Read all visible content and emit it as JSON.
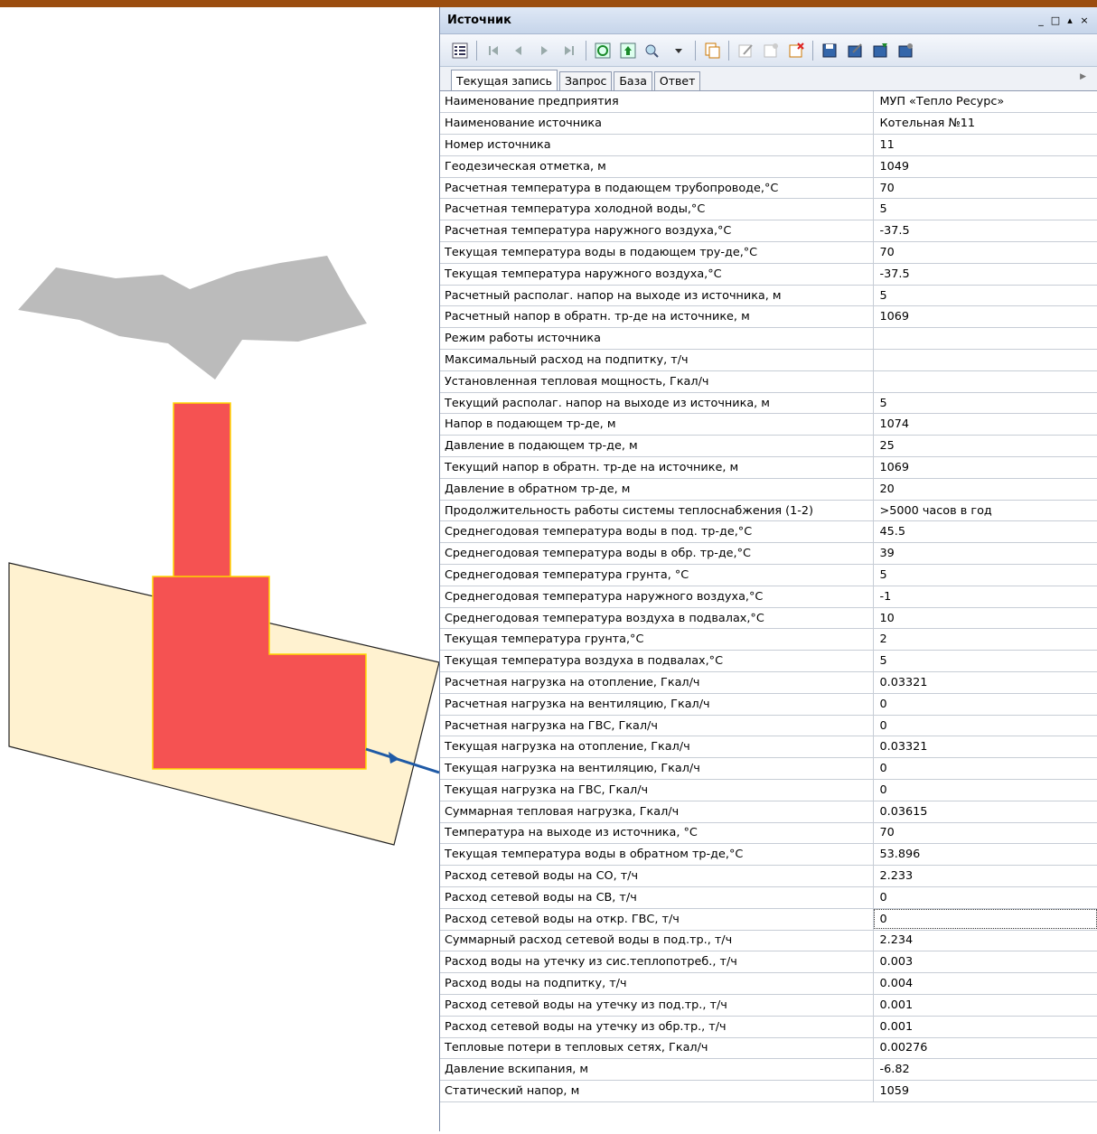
{
  "window": {
    "title": "Источник",
    "controls": [
      "_",
      "□",
      "▴",
      "×"
    ]
  },
  "toolbar": {
    "icons": [
      "grid-menu-icon",
      "first-record-icon",
      "prev-record-icon",
      "next-record-icon",
      "last-record-icon",
      "refresh-icon",
      "update-icon",
      "find-icon",
      "copy-icon",
      "edit-icon",
      "new-record-icon",
      "delete-record-icon",
      "save-icon",
      "export-icon",
      "import-icon",
      "settings-icon"
    ]
  },
  "tabs": [
    "Текущая запись",
    "Запрос",
    "База",
    "Ответ"
  ],
  "rows": [
    {
      "k": "Наименование предприятия",
      "v": "МУП «Тепло Ресурс»"
    },
    {
      "k": "Наименование источника",
      "v": "Котельная №11"
    },
    {
      "k": "Номер источника",
      "v": "11"
    },
    {
      "k": "Геодезическая отметка, м",
      "v": "1049"
    },
    {
      "k": "Расчетная температура в подающем трубопроводе,°С",
      "v": "70"
    },
    {
      "k": "Расчетная температура холодной воды,°С",
      "v": "5"
    },
    {
      "k": "Расчетная температура наружного воздуха,°С",
      "v": "-37.5"
    },
    {
      "k": "Текущая температура воды в подающем тру-де,°С",
      "v": "70"
    },
    {
      "k": "Текущая температура  наружного воздуха,°С",
      "v": "-37.5"
    },
    {
      "k": "Расчетный располаг. напор на выходе из источника, м",
      "v": "5"
    },
    {
      "k": "Расчетный напор в обратн. тр-де на источнике, м",
      "v": "1069"
    },
    {
      "k": "Режим работы источника",
      "v": ""
    },
    {
      "k": "Максимальный расход на подпитку, т/ч",
      "v": ""
    },
    {
      "k": "Установленная тепловая мощность, Гкал/ч",
      "v": ""
    },
    {
      "k": "Текущий располаг. напор на выходе из источника, м",
      "v": "5"
    },
    {
      "k": "Напор в подающем тр-де, м",
      "v": "1074"
    },
    {
      "k": "Давление в подающем тр-де, м",
      "v": "25"
    },
    {
      "k": "Текущий напор в обратн. тр-де на источнике, м",
      "v": "1069"
    },
    {
      "k": "Давление в обратном тр-де, м",
      "v": "20"
    },
    {
      "k": "Продолжительность работы системы теплоснабжения (1-2)",
      "v": ">5000 часов в год"
    },
    {
      "k": "Среднегодовая температура воды в под. тр-де,°С",
      "v": "45.5"
    },
    {
      "k": "Среднегодовая температура воды в обр. тр-де,°С",
      "v": "39"
    },
    {
      "k": "Среднегодовая температура грунта, °С",
      "v": "5"
    },
    {
      "k": "Среднегодовая температура наружного воздуха,°С",
      "v": "-1"
    },
    {
      "k": "Среднегодовая температура воздуха в подвалах,°С",
      "v": "10"
    },
    {
      "k": "Текущая температура грунта,°С",
      "v": "2"
    },
    {
      "k": "Текущая температура воздуха в подвалах,°С",
      "v": "5"
    },
    {
      "k": "Расчетная нагрузка на отопление, Гкал/ч",
      "v": "0.03321"
    },
    {
      "k": "Расчетная нагрузка на вентиляцию, Гкал/ч",
      "v": "0"
    },
    {
      "k": "Расчетная нагрузка на ГВС, Гкал/ч",
      "v": "0"
    },
    {
      "k": "Текущая нагрузка на отопление, Гкал/ч",
      "v": "0.03321"
    },
    {
      "k": "Текущая нагрузка на вентиляцию, Гкал/ч",
      "v": "0"
    },
    {
      "k": "Текущая нагрузка на ГВС, Гкал/ч",
      "v": "0"
    },
    {
      "k": "Суммарная тепловая нагрузка, Гкал/ч",
      "v": "0.03615"
    },
    {
      "k": "Температура на выходе из источника, °С",
      "v": "70"
    },
    {
      "k": "Текущая температура воды в обратном тр-де,°С",
      "v": "53.896"
    },
    {
      "k": "Расход сетевой воды на СО, т/ч",
      "v": "2.233"
    },
    {
      "k": "Расход сетевой воды на СВ, т/ч",
      "v": "0"
    },
    {
      "k": "Расход сетевой воды на откр. ГВС, т/ч",
      "v": "0"
    },
    {
      "k": "Суммарный расход сетевой воды в под.тр., т/ч",
      "v": "2.234"
    },
    {
      "k": "Расход воды на утечку из сис.теплопотреб., т/ч",
      "v": "0.003"
    },
    {
      "k": "Расход воды на подпитку, т/ч",
      "v": "0.004"
    },
    {
      "k": "Расход сетевой воды на утечку из под.тр., т/ч",
      "v": "0.001"
    },
    {
      "k": "Расход сетевой воды на утечку из обр.тр., т/ч",
      "v": "0.001"
    },
    {
      "k": "Тепловые потери в тепловых сетях, Гкал/ч",
      "v": "0.00276"
    },
    {
      "k": "Давление вскипания, м",
      "v": "-6.82"
    },
    {
      "k": "Статический напор, м",
      "v": "1059"
    }
  ],
  "focused_row": 38,
  "colors": {
    "header_bar": "#9b4d0f",
    "boiler": "#f55252",
    "boiler_outline": "#ffd700",
    "building": "#fff2d0",
    "cloud": "#bbbbbb",
    "pipe": "#1f5aa6"
  }
}
